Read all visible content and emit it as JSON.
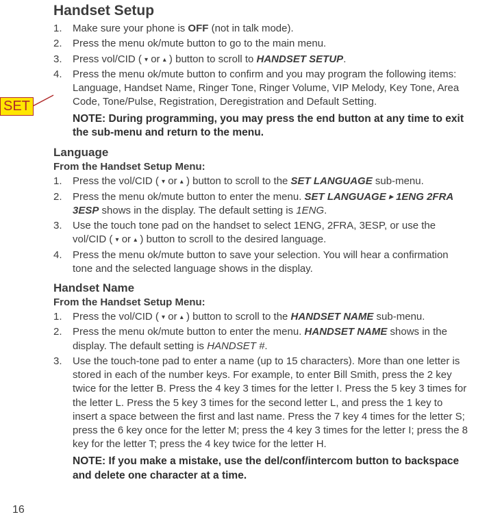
{
  "annotation": {
    "label": "SET"
  },
  "page_number": "16",
  "arrows": {
    "down": "▾",
    "up": "▴",
    "right": "▸"
  },
  "handset_setup": {
    "title": "Handset Setup",
    "steps": {
      "s1_a": "Make sure your phone is ",
      "s1_off": "OFF",
      "s1_b": " (not in talk mode).",
      "s2": "Press the menu ok/mute button to go to the main menu.",
      "s3_a": "Press vol/CID ( ",
      "s3_mid": " or ",
      "s3_b": " ) button to scroll to ",
      "s3_target": "HANDSET SETUP",
      "s3_c": ".",
      "s4": "Press the menu ok/mute button to confirm and you may program the following items: Language, Handset Name, Ringer Tone, Ringer Volume, VIP Melody, Key Tone, Area Code, Tone/Pulse, Registration, Deregistration and Default Setting."
    },
    "note": "NOTE: During programming, you may press the end button at any time to exit the sub-menu and return to the menu."
  },
  "language": {
    "title": "Language",
    "from": "From the Handset Setup Menu:",
    "steps": {
      "s1_a": "Press the vol/CID ( ",
      "s1_mid": " or ",
      "s1_b": " ) button to scroll to the ",
      "s1_target": "SET LANGUAGE",
      "s1_c": " sub-menu.",
      "s2_a": "Press the menu ok/mute button to enter the menu. ",
      "s2_seq": "SET LANGUAGE  ",
      "s2_seq2": " 1ENG 2FRA 3ESP",
      "s2_b": " shows in the display. The default setting is ",
      "s2_def": "1ENG",
      "s2_c": ".",
      "s3_a": "Use the touch tone pad on the handset to select 1ENG, 2FRA, 3ESP, or use the vol/CID ( ",
      "s3_mid": " or ",
      "s3_b": " ) button to scroll to the desired language.",
      "s4": "Press the menu ok/mute button to save your selection. You will hear a confirmation tone and the selected language shows in the display."
    }
  },
  "handset_name": {
    "title": "Handset Name",
    "from": "From the Handset Setup Menu:",
    "steps": {
      "s1_a": "Press the vol/CID ( ",
      "s1_mid": " or ",
      "s1_b": " ) button to scroll to the ",
      "s1_target": "HANDSET NAME",
      "s1_c": " sub-menu.",
      "s2_a": "Press the menu ok/mute button to enter the menu. ",
      "s2_target": "HANDSET NAME",
      "s2_b": " shows in the display. The default setting is ",
      "s2_def": "HANDSET #",
      "s2_c": ".",
      "s3": "Use the touch-tone pad to enter a name (up to 15 characters). More than one letter is stored in each of the number keys. For example, to enter Bill Smith, press the 2 key twice for the letter B. Press the 4 key 3 times for the letter I. Press the 5 key 3 times for the letter L. Press the 5 key 3 times for the second letter L, and press the 1 key to insert a space between the first and last name. Press the 7 key 4 times for the letter S; press the 6 key once for the letter M; press the 4 key 3 times for the letter I; press the 8 key for the letter T; press the 4 key twice for the letter H."
    },
    "note": "NOTE: If you make a mistake, use the del/conf/intercom button to backspace and delete one character at a time."
  }
}
